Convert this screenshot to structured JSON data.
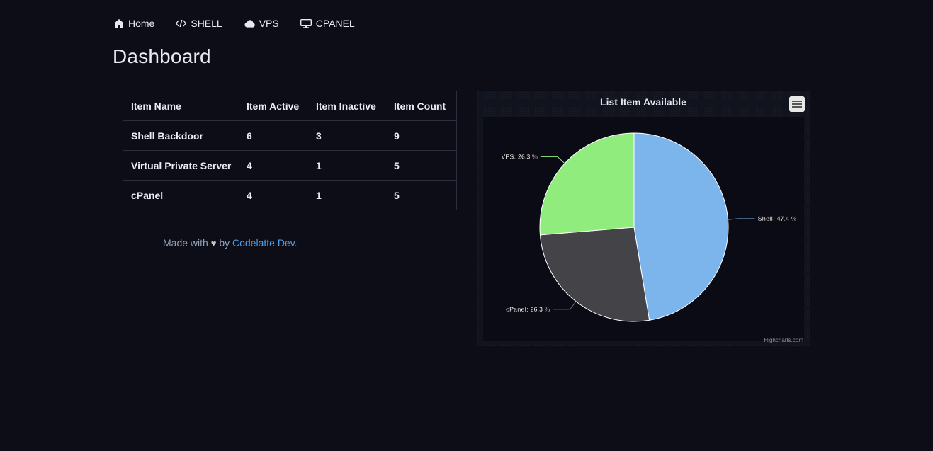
{
  "nav": {
    "items": [
      {
        "label": "Home",
        "icon": "home-icon"
      },
      {
        "label": "SHELL",
        "icon": "code-icon"
      },
      {
        "label": "VPS",
        "icon": "cloud-icon"
      },
      {
        "label": "CPANEL",
        "icon": "desktop-icon"
      }
    ]
  },
  "page": {
    "title": "Dashboard"
  },
  "table": {
    "headers": [
      "Item Name",
      "Item Active",
      "Item Inactive",
      "Item Count"
    ],
    "rows": [
      [
        "Shell Backdoor",
        "6",
        "3",
        "9"
      ],
      [
        "Virtual Private Server",
        "4",
        "1",
        "5"
      ],
      [
        "cPanel",
        "4",
        "1",
        "5"
      ]
    ]
  },
  "footer": {
    "prefix": "Made with",
    "heart": "♥",
    "middle": "by",
    "link": "Codelatte Dev."
  },
  "chart_data": {
    "type": "pie",
    "title": "List Item Available",
    "credits": "Highcharts.com",
    "slices": [
      {
        "name": "Shell",
        "value": 47.4,
        "label": "Shell: 47.4 %",
        "color": "#7cb5ec"
      },
      {
        "name": "cPanel",
        "value": 26.3,
        "label": "cPanel: 26.3 %",
        "color": "#434348"
      },
      {
        "name": "VPS",
        "value": 26.3,
        "label": "VPS: 26.3 %",
        "color": "#90ed7d"
      }
    ]
  },
  "colors": {
    "background": "#0c0d17",
    "link": "#4f9fe8"
  }
}
